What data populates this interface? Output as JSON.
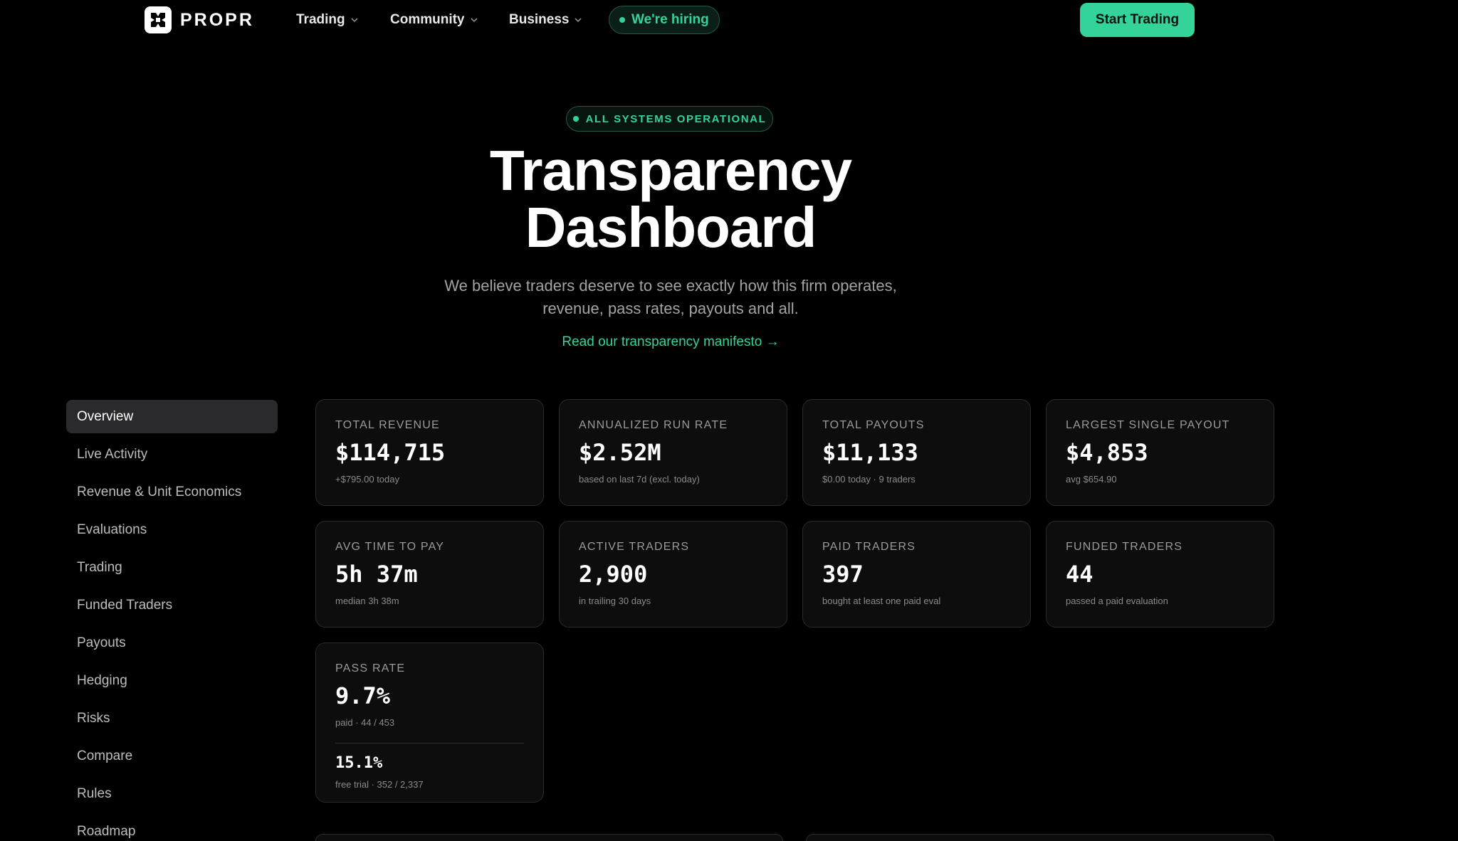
{
  "nav": {
    "brand": "PROPR",
    "items": [
      {
        "label": "Trading"
      },
      {
        "label": "Community"
      },
      {
        "label": "Business"
      }
    ],
    "hiring_label": "We're hiring",
    "cta_label": "Start Trading"
  },
  "hero": {
    "status": "ALL SYSTEMS OPERATIONAL",
    "title_line1": "Transparency",
    "title_line2": "Dashboard",
    "subtitle": "We believe traders deserve to see exactly how this firm operates, revenue, pass rates, payouts and all.",
    "manifesto_link": "Read our transparency manifesto →"
  },
  "sidebar": {
    "items": [
      {
        "label": "Overview",
        "active": true
      },
      {
        "label": "Live Activity"
      },
      {
        "label": "Revenue & Unit Economics"
      },
      {
        "label": "Evaluations"
      },
      {
        "label": "Trading"
      },
      {
        "label": "Funded Traders"
      },
      {
        "label": "Payouts"
      },
      {
        "label": "Hedging"
      },
      {
        "label": "Risks"
      },
      {
        "label": "Compare"
      },
      {
        "label": "Rules"
      },
      {
        "label": "Roadmap"
      }
    ]
  },
  "metrics": {
    "total_revenue": {
      "label": "Total Revenue",
      "value": "$114,715",
      "sub": "+$795.00 today"
    },
    "run_rate": {
      "label": "Annualized Run Rate",
      "value": "$2.52M",
      "sub": "based on last 7d (excl. today)"
    },
    "total_payouts": {
      "label": "Total Payouts",
      "value": "$11,133",
      "sub": "$0.00 today · 9 traders"
    },
    "largest_payout": {
      "label": "Largest Single Payout",
      "value": "$4,853",
      "sub": "avg $654.90"
    },
    "avg_time_to_pay": {
      "label": "Avg Time to Pay",
      "value": "5h 37m",
      "sub": "median 3h 38m"
    },
    "active_traders": {
      "label": "Active Traders",
      "value": "2,900",
      "sub": "in trailing 30 days"
    },
    "paid_traders": {
      "label": "Paid Traders",
      "value": "397",
      "sub": "bought at least one paid eval"
    },
    "funded_traders": {
      "label": "Funded Traders",
      "value": "44",
      "sub": "passed a paid evaluation"
    },
    "pass_rate": {
      "label": "Pass Rate",
      "value": "9.7%",
      "sub": "paid · 44 / 453",
      "value2": "15.1%",
      "sub2": "free trial · 352 / 2,337"
    }
  },
  "colors": {
    "accent": "#34d399",
    "background": "#000000",
    "card": "#0d0d0e"
  }
}
